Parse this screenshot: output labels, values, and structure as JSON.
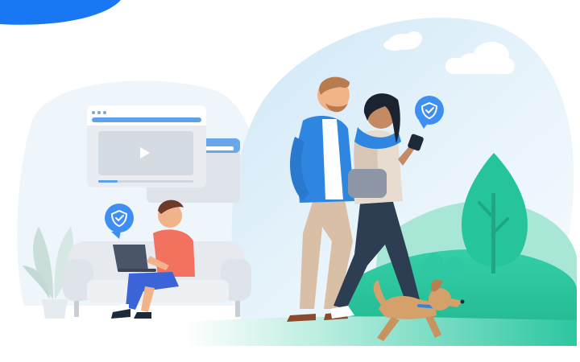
{
  "illustration": {
    "palette": {
      "brand_blue": "#1877f2",
      "sky_light": "#e6f2fb",
      "sky_mid": "#bfe1f5",
      "ground_green": "#2bc7a0",
      "tree_green": "#27c49a",
      "shield_blue": "#3f8ff2",
      "browser_gray": "#d7dde4",
      "couch_gray": "#e3e7ec",
      "skin": "#f1b48a",
      "dog_tan": "#d6a06a"
    },
    "icons": [
      "shield-check-icon",
      "shield-check-icon",
      "shield-check-icon",
      "play-icon"
    ],
    "characters": [
      "man-walking",
      "woman-with-phone",
      "boy-on-couch-with-laptop",
      "dog-running"
    ]
  }
}
